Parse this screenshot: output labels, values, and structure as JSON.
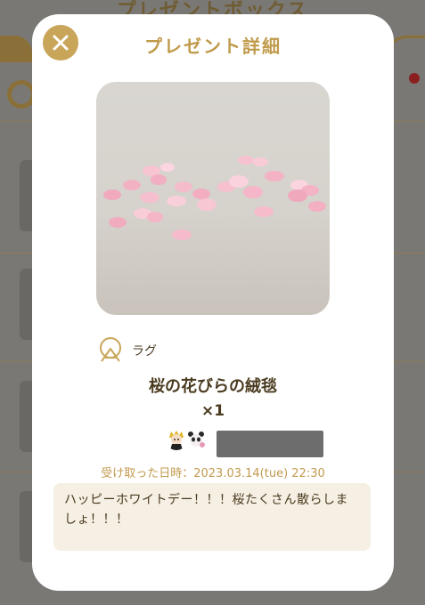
{
  "background": {
    "title": "プレゼントボックス",
    "bottom_text": "……",
    "notify_color": "#8a1f1f"
  },
  "modal": {
    "title": "プレゼント詳細",
    "close_icon": "close-icon",
    "accent_color": "#c9a55a"
  },
  "item": {
    "image_icon": "sakura-petal-rug-image",
    "category_icon": "rug-icon",
    "category_label": "ラグ",
    "name": "桜の花びらの絨毯",
    "quantity": "×1"
  },
  "sender": {
    "avatar_icons": [
      "blonde-character-avatar",
      "panda-character-avatar"
    ],
    "name_redacted": true
  },
  "received": {
    "text": "受け取った日時：2023.03.14(tue) 22:30"
  },
  "message": {
    "text": "ハッピーホワイトデー！！！桜たくさん散らしましょ！！！"
  }
}
